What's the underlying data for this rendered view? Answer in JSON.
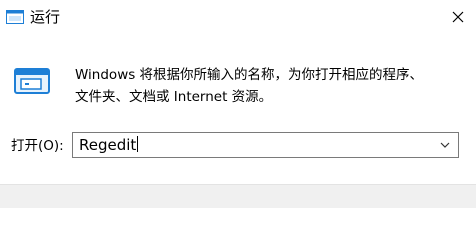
{
  "window": {
    "title": "运行",
    "icon": "run-app-icon",
    "close_icon": "close-icon"
  },
  "main": {
    "description_line1": "Windows 将根据你所输入的名称，为你打开相应的程序、",
    "description_line2": "文件夹、文档或 Internet 资源。",
    "open_label": "打开(O):",
    "command_value": "Regedit",
    "dropdown_icon": "chevron-down-icon"
  },
  "colors": {
    "accent": "#1e7fd6",
    "footer_bg": "#f0f0f0",
    "border": "#7a7a7a"
  }
}
